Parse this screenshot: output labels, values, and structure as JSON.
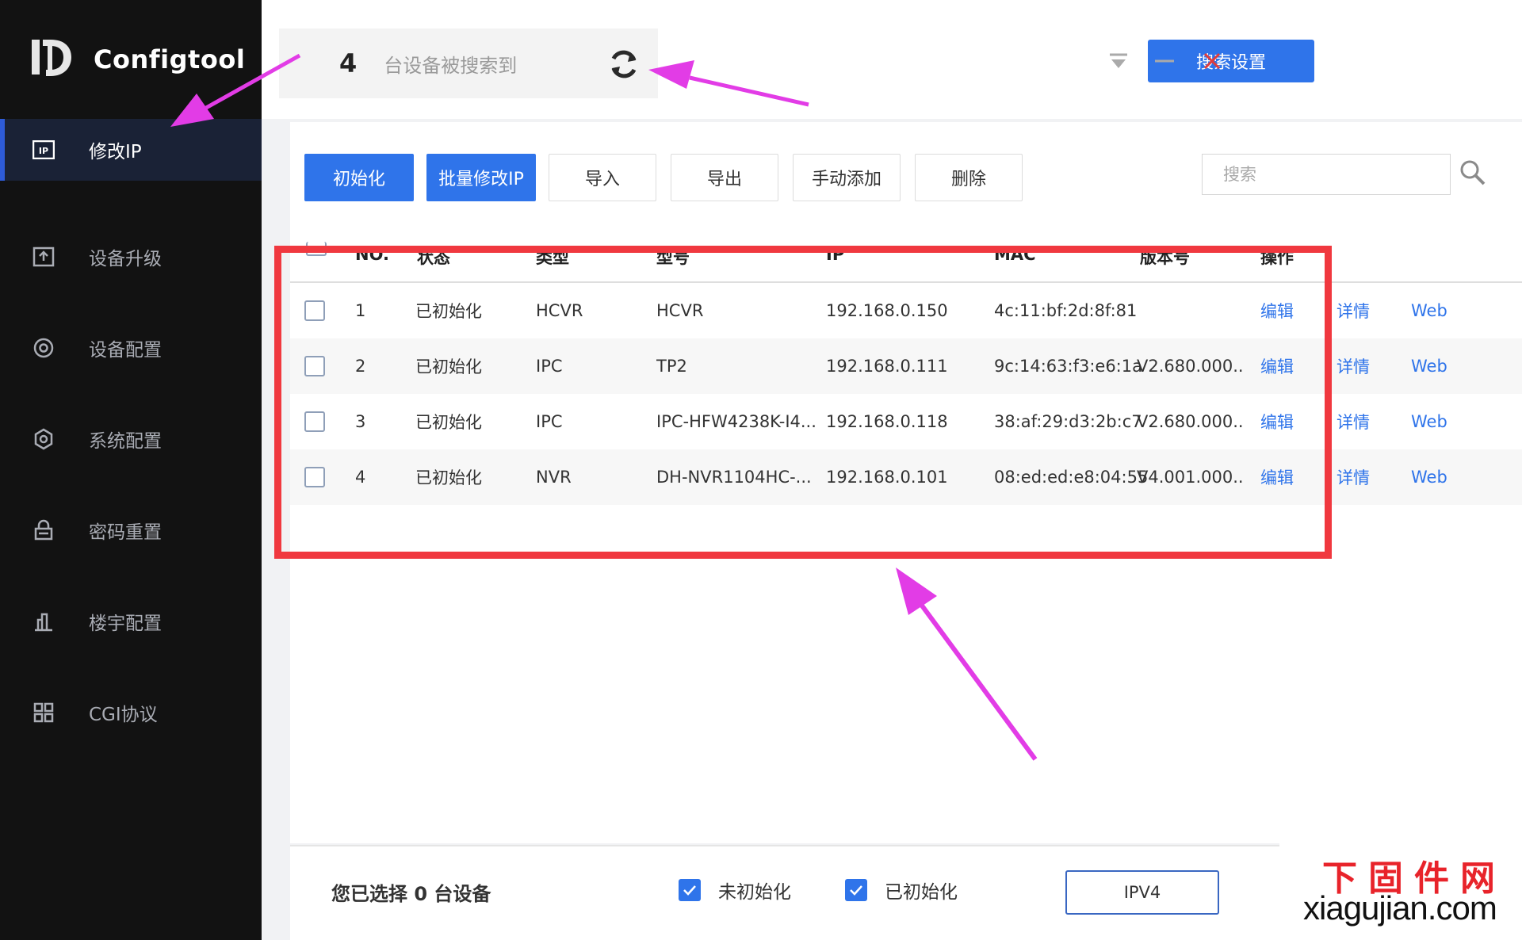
{
  "app": {
    "name": "Configtool"
  },
  "sidebar": {
    "items": [
      {
        "label": "修改IP",
        "icon": "ip-icon",
        "active": true
      },
      {
        "label": "设备升级",
        "icon": "upgrade-icon",
        "active": false
      },
      {
        "label": "设备配置",
        "icon": "device-config-icon",
        "active": false
      },
      {
        "label": "系统配置",
        "icon": "system-config-icon",
        "active": false
      },
      {
        "label": "密码重置",
        "icon": "password-reset-icon",
        "active": false
      },
      {
        "label": "楼宇配置",
        "icon": "building-config-icon",
        "active": false
      },
      {
        "label": "CGI协议",
        "icon": "cgi-protocol-icon",
        "active": false
      }
    ]
  },
  "header": {
    "device_count": "4",
    "status_text": "台设备被搜索到",
    "search_settings_label": "搜索设置"
  },
  "toolbar": {
    "init_label": "初始化",
    "batch_modify_label": "批量修改IP",
    "import_label": "导入",
    "export_label": "导出",
    "manual_add_label": "手动添加",
    "delete_label": "删除",
    "search_placeholder": "搜索"
  },
  "table": {
    "headers": {
      "no": "NO.",
      "status": "状态",
      "type": "类型",
      "model": "型号",
      "ip": "IP",
      "mac": "MAC",
      "version": "版本号",
      "action": "操作"
    },
    "rows": [
      {
        "no": "1",
        "status": "已初始化",
        "type": "HCVR",
        "model": "HCVR",
        "ip": "192.168.0.150",
        "mac": "4c:11:bf:2d:8f:81",
        "version": "",
        "edit": "编辑",
        "detail": "详情",
        "web": "Web"
      },
      {
        "no": "2",
        "status": "已初始化",
        "type": "IPC",
        "model": "TP2",
        "ip": "192.168.0.111",
        "mac": "9c:14:63:f3:e6:1a",
        "version": "V2.680.000...",
        "edit": "编辑",
        "detail": "详情",
        "web": "Web"
      },
      {
        "no": "3",
        "status": "已初始化",
        "type": "IPC",
        "model": "IPC-HFW4238K-I4...",
        "ip": "192.168.0.118",
        "mac": "38:af:29:d3:2b:c7",
        "version": "V2.680.000...",
        "edit": "编辑",
        "detail": "详情",
        "web": "Web"
      },
      {
        "no": "4",
        "status": "已初始化",
        "type": "NVR",
        "model": "DH-NVR1104HC-...",
        "ip": "192.168.0.101",
        "mac": "08:ed:ed:e8:04:55",
        "version": "V4.001.000...",
        "edit": "编辑",
        "detail": "详情",
        "web": "Web"
      }
    ]
  },
  "footer": {
    "selected_text": "您已选择 0 台设备",
    "filter_uninit": "未初始化",
    "filter_init": "已初始化",
    "ipv4_tab": "IPV4"
  },
  "watermark": {
    "top": "下固件网",
    "bottom": "xiagujian.com"
  },
  "colors": {
    "accent": "#2f74ea",
    "sidebar_bg": "#121212",
    "highlight_box": "#f0383f",
    "arrow": "#e23ce6"
  }
}
